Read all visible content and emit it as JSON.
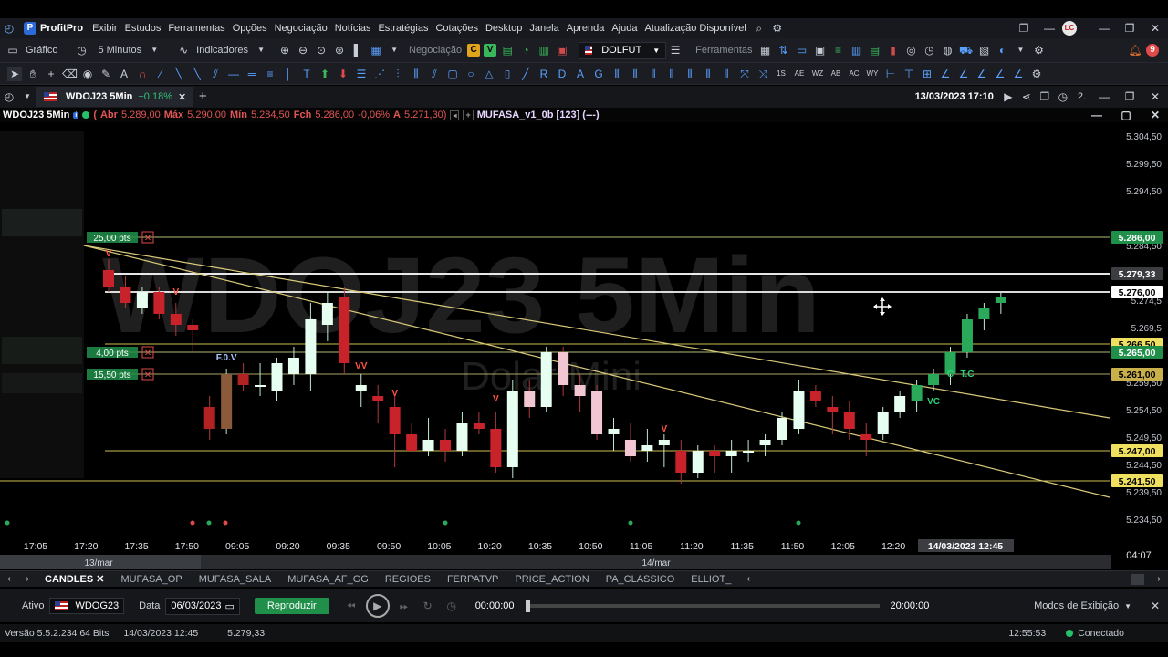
{
  "app": {
    "name": "ProfitPro",
    "menu": [
      "Exibir",
      "Estudos",
      "Ferramentas",
      "Opções",
      "Negociação",
      "Notícias",
      "Estratégias",
      "Cotações",
      "Desktop",
      "Janela",
      "Aprenda",
      "Ajuda",
      "Atualização Disponível"
    ],
    "avatar_initials": "LC"
  },
  "toolbar": {
    "grafico_label": "Gráfico",
    "timeframe": "5 Minutos",
    "indicadores_label": "Indicadores",
    "negociacao_label": "Negociação",
    "c_badge": "C",
    "v_badge": "V",
    "asset_select": "DOLFUT",
    "ferramentas_label": "Ferramentas",
    "notif_count": "9"
  },
  "chart_tab": {
    "title": "WDOJ23 5Min",
    "change": "+0,18%",
    "datetime": "13/03/2023 17:10",
    "page_indicator": "2."
  },
  "chart_header": {
    "symbol": "WDOJ23 5Min",
    "ohlc_open_label": "Abr",
    "ohlc_open": "5.289,00",
    "ohlc_high_label": "Máx",
    "ohlc_high": "5.290,00",
    "ohlc_low_label": "Mín",
    "ohlc_low": "5.284,50",
    "ohlc_close_label": "Fch",
    "ohlc_close": "5.286,00",
    "ohlc_change": "-0,06%",
    "ohlc_a_label": "A",
    "ohlc_a": "5.271,30)",
    "study": "MUFASA_v1_0b [123] (---)"
  },
  "chart_data": {
    "type": "candlestick",
    "watermark_title": "WDOJ23 5Min",
    "watermark_subtitle": "Dolar Mini",
    "y_ticks": [
      "5.304,50",
      "5.299,50",
      "5.294,50",
      "5.284,50",
      "5.274,5",
      "5.269,5",
      "5.259,50",
      "5.254,50",
      "5.249,50",
      "5.244,50",
      "5.239,50",
      "5.234,50"
    ],
    "y_tick_values": [
      5304.5,
      5299.5,
      5294.5,
      5284.5,
      5274.5,
      5269.5,
      5259.5,
      5254.5,
      5249.5,
      5244.5,
      5239.5,
      5234.5
    ],
    "ylim": [
      5231.0,
      5307.0
    ],
    "x_ticks": [
      "17:05",
      "17:20",
      "17:35",
      "17:50",
      "09:05",
      "09:20",
      "09:35",
      "09:50",
      "10:05",
      "10:20",
      "10:35",
      "10:50",
      "11:05",
      "11:20",
      "11:35",
      "11:50",
      "12:05",
      "12:20"
    ],
    "x_highlight": "14/03/2023 12:45",
    "date_labels": [
      "13/mar",
      "14/mar"
    ],
    "corner_label": "04:07",
    "price_lines": [
      {
        "price": 5286.0,
        "label": "5.286,00",
        "style": "green"
      },
      {
        "price": 5279.33,
        "label": "5.279,33",
        "style": "gray"
      },
      {
        "price": 5276.0,
        "label": "5.276,00",
        "style": "white"
      },
      {
        "price": 5266.5,
        "label": "5.266,50",
        "style": "yellow"
      },
      {
        "price": 5265.0,
        "label": "5.265,00",
        "style": "green"
      },
      {
        "price": 5261.0,
        "label": "5.261,00",
        "style": "yellowdark"
      },
      {
        "price": 5247.0,
        "label": "5.247,00",
        "style": "yellow"
      },
      {
        "price": 5241.5,
        "label": "5.241,50",
        "style": "yellow"
      }
    ],
    "pts_labels": [
      {
        "text": "25,00 pts",
        "price": 5286.0
      },
      {
        "text": "4,00 pts",
        "price": 5265.0
      },
      {
        "text": "15,50 pts",
        "price": 5261.0
      }
    ],
    "candles": [
      {
        "o": 5280,
        "h": 5282,
        "l": 5276,
        "c": 5277
      },
      {
        "o": 5277,
        "h": 5279,
        "l": 5273,
        "c": 5274
      },
      {
        "o": 5273,
        "h": 5277,
        "l": 5272,
        "c": 5276
      },
      {
        "o": 5276,
        "h": 5277,
        "l": 5271,
        "c": 5272
      },
      {
        "o": 5272,
        "h": 5274,
        "l": 5268,
        "c": 5270
      },
      {
        "o": 5270,
        "h": 5271,
        "l": 5265,
        "c": 5269
      },
      {
        "o": 5255,
        "h": 5257,
        "l": 5249,
        "c": 5251
      },
      {
        "o": 5251,
        "h": 5262,
        "l": 5250,
        "c": 5261
      },
      {
        "o": 5261,
        "h": 5263,
        "l": 5258,
        "c": 5259
      },
      {
        "o": 5259,
        "h": 5263,
        "l": 5257,
        "c": 5259
      },
      {
        "o": 5258,
        "h": 5264,
        "l": 5256,
        "c": 5263
      },
      {
        "o": 5261,
        "h": 5266,
        "l": 5259,
        "c": 5264
      },
      {
        "o": 5261,
        "h": 5274,
        "l": 5258,
        "c": 5271
      },
      {
        "o": 5270,
        "h": 5276,
        "l": 5267,
        "c": 5274
      },
      {
        "o": 5275,
        "h": 5277,
        "l": 5261,
        "c": 5263
      },
      {
        "o": 5258,
        "h": 5261,
        "l": 5255,
        "c": 5259
      },
      {
        "o": 5257,
        "h": 5259,
        "l": 5252,
        "c": 5256
      },
      {
        "o": 5255,
        "h": 5257,
        "l": 5244,
        "c": 5250
      },
      {
        "o": 5250,
        "h": 5252,
        "l": 5247,
        "c": 5247
      },
      {
        "o": 5247,
        "h": 5253,
        "l": 5246,
        "c": 5249
      },
      {
        "o": 5249,
        "h": 5251,
        "l": 5245,
        "c": 5247
      },
      {
        "o": 5247,
        "h": 5254,
        "l": 5246,
        "c": 5252
      },
      {
        "o": 5252,
        "h": 5254,
        "l": 5250,
        "c": 5251
      },
      {
        "o": 5251,
        "h": 5254,
        "l": 5243,
        "c": 5244
      },
      {
        "o": 5244,
        "h": 5260,
        "l": 5242,
        "c": 5258
      },
      {
        "o": 5258,
        "h": 5260,
        "l": 5253,
        "c": 5255
      },
      {
        "o": 5255,
        "h": 5266,
        "l": 5254,
        "c": 5265
      },
      {
        "o": 5265,
        "h": 5266,
        "l": 5257,
        "c": 5259
      },
      {
        "o": 5259,
        "h": 5261,
        "l": 5254,
        "c": 5257
      },
      {
        "o": 5258,
        "h": 5259,
        "l": 5249,
        "c": 5250
      },
      {
        "o": 5250,
        "h": 5253,
        "l": 5247,
        "c": 5251
      },
      {
        "o": 5249,
        "h": 5252,
        "l": 5245,
        "c": 5246
      },
      {
        "o": 5247,
        "h": 5251,
        "l": 5245,
        "c": 5248
      },
      {
        "o": 5248,
        "h": 5250,
        "l": 5244,
        "c": 5249
      },
      {
        "o": 5247,
        "h": 5249,
        "l": 5241,
        "c": 5243
      },
      {
        "o": 5243,
        "h": 5248,
        "l": 5242,
        "c": 5247
      },
      {
        "o": 5247,
        "h": 5248,
        "l": 5243,
        "c": 5246
      },
      {
        "o": 5246,
        "h": 5249,
        "l": 5243,
        "c": 5247
      },
      {
        "o": 5247,
        "h": 5249,
        "l": 5245,
        "c": 5247
      },
      {
        "o": 5248,
        "h": 5250,
        "l": 5246,
        "c": 5249
      },
      {
        "o": 5249,
        "h": 5254,
        "l": 5248,
        "c": 5253
      },
      {
        "o": 5251,
        "h": 5260,
        "l": 5250,
        "c": 5258
      },
      {
        "o": 5258,
        "h": 5259,
        "l": 5255,
        "c": 5256
      },
      {
        "o": 5255,
        "h": 5257,
        "l": 5250,
        "c": 5254
      },
      {
        "o": 5254,
        "h": 5256,
        "l": 5249,
        "c": 5251
      },
      {
        "o": 5250,
        "h": 5252,
        "l": 5246,
        "c": 5249
      },
      {
        "o": 5250,
        "h": 5255,
        "l": 5249,
        "c": 5254
      },
      {
        "o": 5254,
        "h": 5258,
        "l": 5253,
        "c": 5257
      },
      {
        "o": 5256,
        "h": 5260,
        "l": 5254,
        "c": 5259
      },
      {
        "o": 5259,
        "h": 5262,
        "l": 5258,
        "c": 5261
      },
      {
        "o": 5261,
        "h": 5266,
        "l": 5259,
        "c": 5265
      },
      {
        "o": 5265,
        "h": 5272,
        "l": 5264,
        "c": 5271
      },
      {
        "o": 5271,
        "h": 5274,
        "l": 5269,
        "c": 5273
      },
      {
        "o": 5274,
        "h": 5276,
        "l": 5272,
        "c": 5275
      }
    ],
    "annotations": [
      {
        "text": "V",
        "candle": 0,
        "price": 5282.5,
        "color": "#ff5540"
      },
      {
        "text": "V",
        "candle": 4,
        "price": 5275.5,
        "color": "#ff5540"
      },
      {
        "text": "F.0.V",
        "candle": 7,
        "price": 5263.5,
        "color": "#a9c6ff"
      },
      {
        "text": "VV",
        "candle": 15,
        "price": 5262.0,
        "color": "#ff5540"
      },
      {
        "text": "V",
        "candle": 17,
        "price": 5257.0,
        "color": "#ff5540"
      },
      {
        "text": "V",
        "candle": 23,
        "price": 5256.0,
        "color": "#ff5540"
      },
      {
        "text": "V",
        "candle": 33,
        "price": 5250.5,
        "color": "#ff5540"
      },
      {
        "text": "VC",
        "candle": 49,
        "price": 5255.5,
        "color": "#2ed17a"
      },
      {
        "text": "C",
        "candle": 50,
        "price": 5260.5,
        "color": "#2ed17a"
      },
      {
        "text": "T.C",
        "candle": 51,
        "price": 5260.5,
        "color": "#2ed17a"
      }
    ],
    "trendlines": [
      {
        "from": [
          0,
          5284.5
        ],
        "to": [
          59,
          5253.0
        ]
      },
      {
        "from": [
          0,
          5284.5
        ],
        "to": [
          59,
          5238.5
        ]
      }
    ]
  },
  "bottom_tabs": [
    "CANDLES",
    "MUFASA_OP",
    "MUFASA_SALA",
    "MUFASA_AF_GG",
    "REGIOES",
    "FERPATVP",
    "PRICE_ACTION",
    "PA_CLASSICO",
    "ELLIOT_"
  ],
  "replay": {
    "ativo_label": "Ativo",
    "ativo_value": "WDOG23",
    "data_label": "Data",
    "data_value": "06/03/2023",
    "reproduzir_label": "Reproduzir",
    "time_start": "00:00:00",
    "time_end": "20:00:00",
    "progress": 0,
    "modos_label": "Modos de Exibição"
  },
  "status": {
    "version": "Versão 5.5.2.234 64 Bits",
    "datetime": "14/03/2023 12:45",
    "price": "5.279,33",
    "clock": "12:55:53",
    "connection": "Conectado"
  }
}
